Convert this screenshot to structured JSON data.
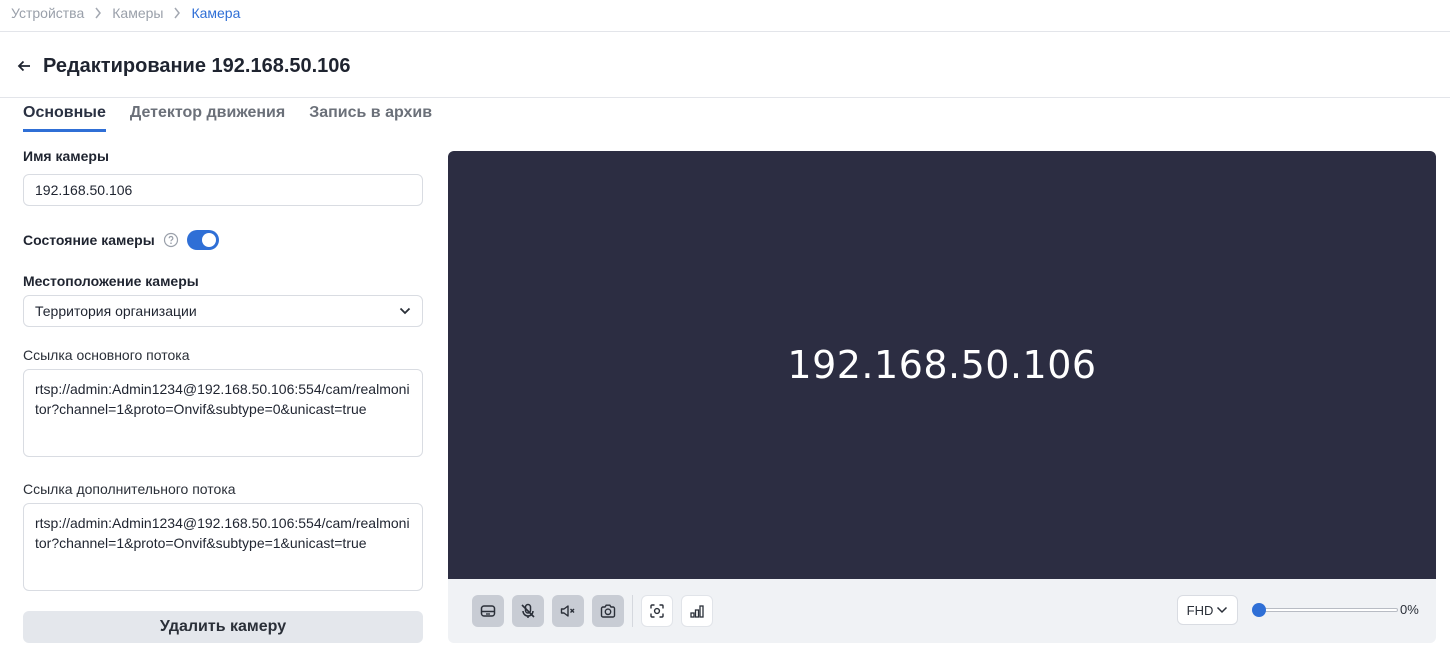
{
  "breadcrumb": {
    "items": [
      "Устройства",
      "Камеры",
      "Камера"
    ]
  },
  "header": {
    "title": "Редактирование 192.168.50.106"
  },
  "tabs": [
    {
      "label": "Основные",
      "active": true
    },
    {
      "label": "Детектор движения",
      "active": false
    },
    {
      "label": "Запись в архив",
      "active": false
    }
  ],
  "form": {
    "camera_name_label": "Имя камеры",
    "camera_name_value": "192.168.50.106",
    "camera_state_label": "Состояние камеры",
    "camera_state_on": true,
    "location_label": "Местоположение камеры",
    "location_value": "Территория организации",
    "main_stream_label": "Ссылка основного потока",
    "main_stream_value": "rtsp://admin:Admin1234@192.168.50.106:554/cam/realmonitor?channel=1&proto=Onvif&subtype=0&unicast=true",
    "sub_stream_label": "Ссылка дополнительного потока",
    "sub_stream_value": "rtsp://admin:Admin1234@192.168.50.106:554/cam/realmonitor?channel=1&proto=Onvif&subtype=1&unicast=true",
    "delete_label": "Удалить камеру"
  },
  "player": {
    "video_label": "192.168.50.106",
    "quality": "FHD",
    "zoom_percent": 0,
    "zoom_label": "0%",
    "controls": [
      "archive-icon",
      "mic-off-icon",
      "speaker-muted-icon",
      "snapshot-icon",
      "focus-icon",
      "signal-icon"
    ]
  },
  "colors": {
    "accent": "#2f6fd6",
    "video_bg": "#2c2d42",
    "control_bar_bg": "#f0f2f5"
  }
}
